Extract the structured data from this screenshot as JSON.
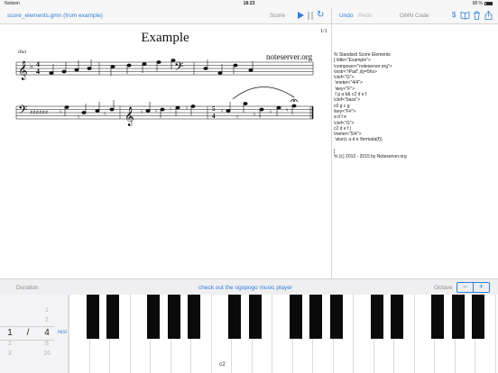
{
  "status_bar": {
    "carrier": "Notizen",
    "time": "18:23",
    "battery": "98 %"
  },
  "toolbar": {
    "document_title": "score_elements.gmn (from example)",
    "score_label": "Score",
    "undo_label": "Undo",
    "redo_label": "Redo",
    "gmn_code_label": "GMN Code",
    "dollar_label": "$"
  },
  "score": {
    "title": "Example",
    "composer": "noteserver.org",
    "instrument": "iPad",
    "page_indicator": "1/1"
  },
  "code_lines": [
    "% Standard Score Elements",
    "[ \\title<\"Example\">",
    "\\composer<\"noteserver.org\">",
    "\\instr<\"iPad\",dy=5hs>",
    "\\clef<\"G\">",
    " \\meter<\"4/4\">",
    " \\key<\"F\">",
    " f g a b& c2 d e f",
    "\\clef<\"bass\">",
    "c0 g c g",
    "\\key<\"F#\">",
    "a d f e",
    "\\clef<\"G\">",
    "c2 d e f |",
    "\\meter<\"5/4\">",
    " \\slur(c a d e \\fermata(f))",
    "",
    "]",
    "% (c) 2012 - 2015 by Noteserver.org"
  ],
  "bottom_bar": {
    "duration_label": "Duration",
    "promo_link": "check out the ogopogo music player",
    "octave_label": "Octave",
    "octave_minus": "−",
    "octave_plus": "+"
  },
  "duration_picker": {
    "numerator_selected": "1",
    "separator": "/",
    "denominator_selected": "4",
    "denominators_above": [
      "1",
      "2"
    ],
    "numerators_below": [
      "2",
      "3"
    ],
    "denominators_below": [
      "8",
      "16"
    ],
    "rest_label": "rest"
  },
  "keyboard": {
    "c_label": "c2"
  },
  "colors": {
    "accent": "#2f7fd8",
    "disabled": "#c0c0c0",
    "toolbar_bg": "#f7f7f7"
  }
}
